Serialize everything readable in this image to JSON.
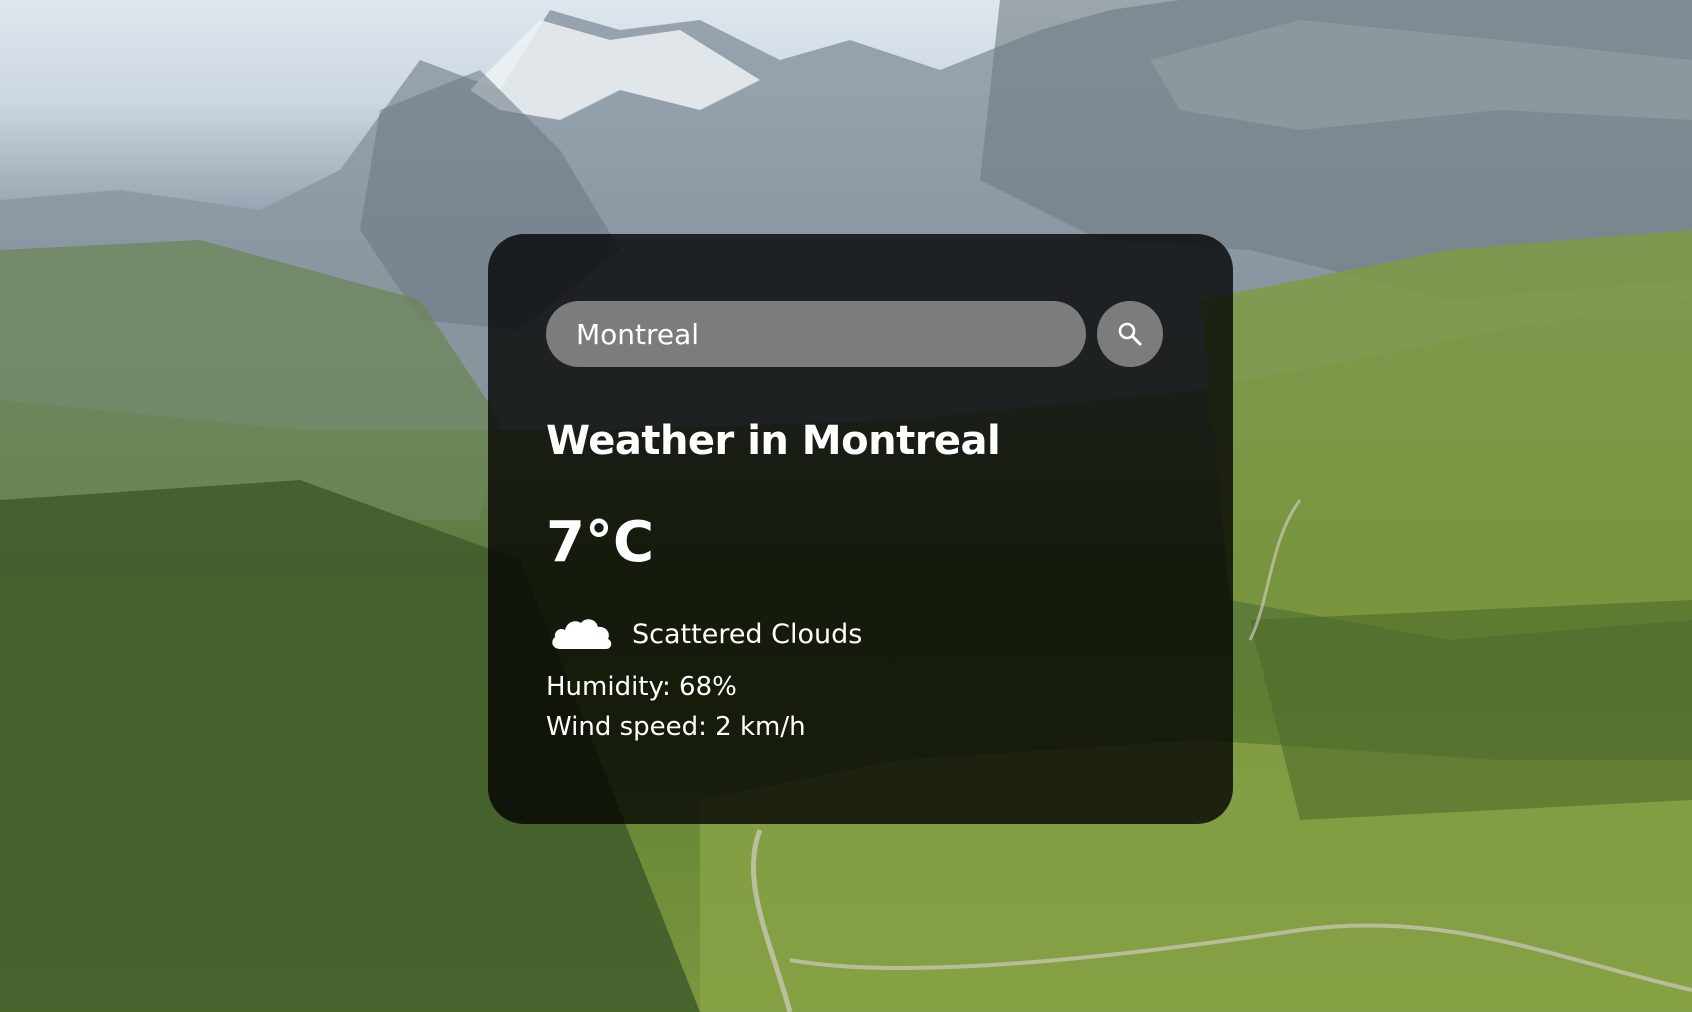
{
  "search": {
    "value": "Montreal",
    "placeholder": "Search",
    "button_icon": "search-icon"
  },
  "weather": {
    "title": "Weather in Montreal",
    "temperature": "7°C",
    "description": "Scattered Clouds",
    "description_icon": "cloud-icon",
    "humidity": "Humidity: 68%",
    "wind": "Wind speed: 2 km/h"
  },
  "colors": {
    "card_background": "rgba(0, 0, 0, 0.78)",
    "input_background": "#7c7c7c",
    "text": "#ffffff"
  }
}
